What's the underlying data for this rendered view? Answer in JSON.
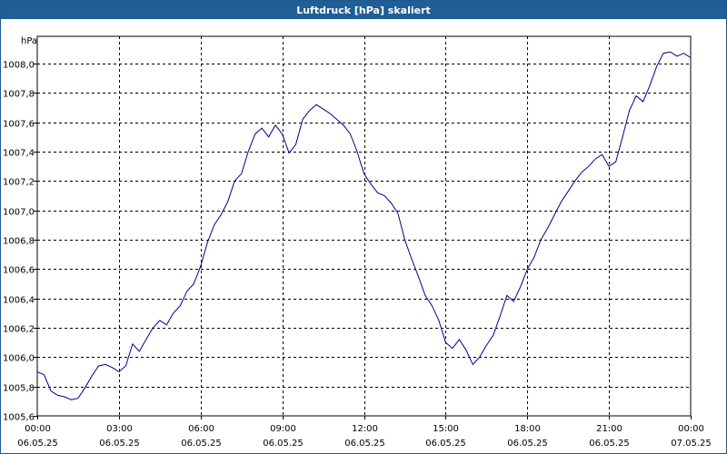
{
  "window": {
    "title": "Luftdruck [hPa] skaliert"
  },
  "chart_data": {
    "type": "line",
    "title": "Luftdruck [hPa] skaliert",
    "ylabel": "hPa",
    "xlabel": "",
    "ylim": [
      1005.6,
      1008.1
    ],
    "xlim": [
      0,
      24
    ],
    "y_ticks": [
      {
        "value": 1005.6,
        "label": "1005,6"
      },
      {
        "value": 1005.8,
        "label": "1005,8"
      },
      {
        "value": 1006.0,
        "label": "1006,0"
      },
      {
        "value": 1006.2,
        "label": "1006,2"
      },
      {
        "value": 1006.4,
        "label": "1006,4"
      },
      {
        "value": 1006.6,
        "label": "1006,6"
      },
      {
        "value": 1006.8,
        "label": "1006,8"
      },
      {
        "value": 1007.0,
        "label": "1007,0"
      },
      {
        "value": 1007.2,
        "label": "1007,2"
      },
      {
        "value": 1007.4,
        "label": "1007,4"
      },
      {
        "value": 1007.6,
        "label": "1007,6"
      },
      {
        "value": 1007.8,
        "label": "1007,8"
      },
      {
        "value": 1008.0,
        "label": "1008,0"
      }
    ],
    "x_ticks": [
      {
        "value": 0,
        "time": "00:00",
        "date": "06.05.25"
      },
      {
        "value": 3,
        "time": "03:00",
        "date": "06.05.25"
      },
      {
        "value": 6,
        "time": "06:00",
        "date": "06.05.25"
      },
      {
        "value": 9,
        "time": "09:00",
        "date": "06.05.25"
      },
      {
        "value": 12,
        "time": "12:00",
        "date": "06.05.25"
      },
      {
        "value": 15,
        "time": "15:00",
        "date": "06.05.25"
      },
      {
        "value": 18,
        "time": "18:00",
        "date": "06.05.25"
      },
      {
        "value": 21,
        "time": "21:00",
        "date": "06.05.25"
      },
      {
        "value": 24,
        "time": "00:00",
        "date": "07.05.25"
      }
    ],
    "grid": true,
    "line_color": "#00008b",
    "series": [
      {
        "x": [
          0,
          0.25,
          0.5,
          0.75,
          1,
          1.25,
          1.5,
          1.75,
          2,
          2.25,
          2.5,
          2.75,
          3,
          3.25,
          3.5,
          3.75,
          4,
          4.25,
          4.5,
          4.75,
          5,
          5.25,
          5.5,
          5.75,
          6,
          6.25,
          6.5,
          6.75,
          7,
          7.25,
          7.5,
          7.75,
          8,
          8.25,
          8.5,
          8.75,
          9,
          9.25,
          9.5,
          9.75,
          10,
          10.25,
          10.5,
          10.75,
          11,
          11.25,
          11.5,
          11.75,
          12,
          12.25,
          12.5,
          12.75,
          13,
          13.25,
          13.5,
          13.75,
          14,
          14.25,
          14.5,
          14.75,
          15,
          15.25,
          15.5,
          15.75,
          16,
          16.25,
          16.5,
          16.75,
          17,
          17.25,
          17.5,
          17.75,
          18,
          18.25,
          18.5,
          18.75,
          19,
          19.25,
          19.5,
          19.75,
          20,
          20.25,
          20.5,
          20.75,
          21,
          21.25,
          21.5,
          21.75,
          22,
          22.25,
          22.5,
          22.75,
          23,
          23.25,
          23.5,
          23.75,
          24
        ],
        "y": [
          1005.9,
          1005.88,
          1005.77,
          1005.74,
          1005.73,
          1005.71,
          1005.72,
          1005.79,
          1005.87,
          1005.94,
          1005.95,
          1005.93,
          1005.9,
          1005.94,
          1006.09,
          1006.04,
          1006.12,
          1006.2,
          1006.25,
          1006.22,
          1006.3,
          1006.35,
          1006.45,
          1006.5,
          1006.62,
          1006.78,
          1006.9,
          1006.97,
          1007.06,
          1007.2,
          1007.25,
          1007.4,
          1007.52,
          1007.56,
          1007.5,
          1007.58,
          1007.52,
          1007.39,
          1007.45,
          1007.62,
          1007.68,
          1007.72,
          1007.69,
          1007.66,
          1007.62,
          1007.58,
          1007.52,
          1007.4,
          1007.25,
          1007.18,
          1007.12,
          1007.1,
          1007.05,
          1006.98,
          1006.8,
          1006.67,
          1006.55,
          1006.42,
          1006.35,
          1006.25,
          1006.1,
          1006.06,
          1006.12,
          1006.05,
          1005.95,
          1006.0,
          1006.08,
          1006.15,
          1006.28,
          1006.42,
          1006.38,
          1006.48,
          1006.6,
          1006.68,
          1006.8,
          1006.88,
          1006.97,
          1007.06,
          1007.13,
          1007.2,
          1007.26,
          1007.3,
          1007.35,
          1007.38,
          1007.3,
          1007.33,
          1007.5,
          1007.68,
          1007.78,
          1007.74,
          1007.85,
          1007.98,
          1008.07,
          1008.08,
          1008.05,
          1008.07,
          1008.04
        ]
      }
    ]
  }
}
